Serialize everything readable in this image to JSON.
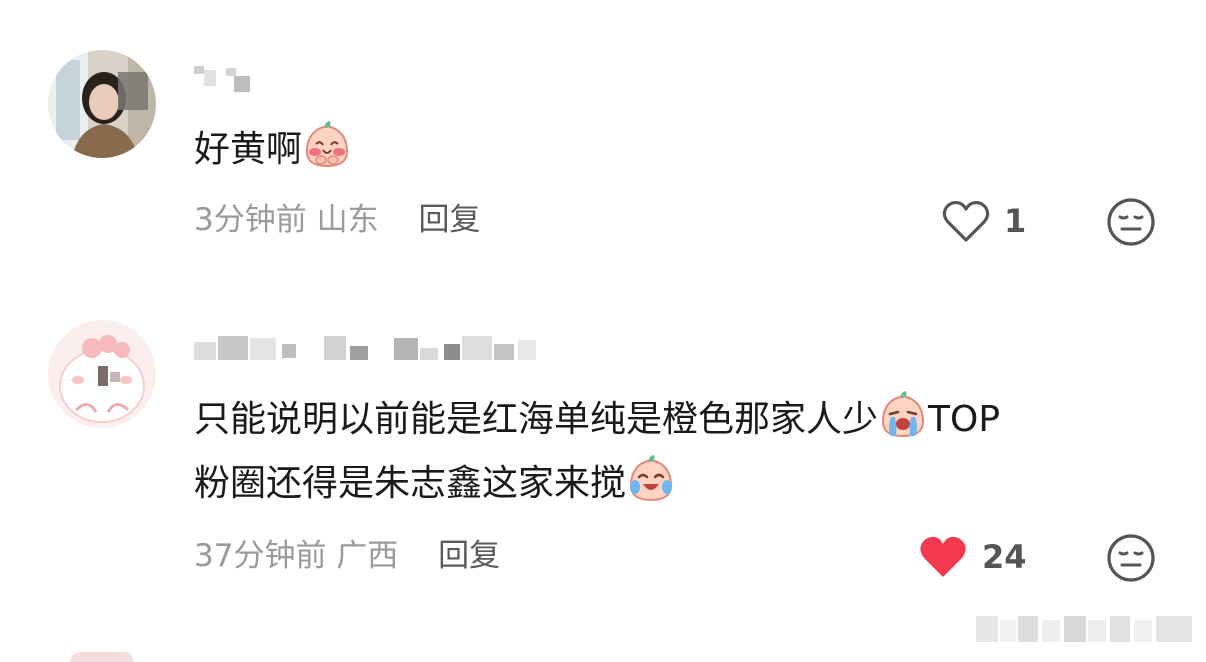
{
  "comments": [
    {
      "content_text": "好黄啊",
      "emoji": "blushing-peach-face-emoji",
      "time": "3分钟前",
      "location": "山东",
      "reply_label": "回复",
      "like_count": "1",
      "liked": false
    },
    {
      "content_line1": "只能说明以前能是红海单纯是橙色那家人少",
      "content_line1_tail": "TOP",
      "content_line2": "粉圈还得是朱志鑫这家来搅",
      "emoji1": "crying-peach-face-emoji",
      "emoji2": "laughing-tears-peach-face-emoji",
      "time": "37分钟前",
      "location": "广西",
      "reply_label": "回复",
      "like_count": "24",
      "liked": true
    }
  ],
  "colors": {
    "liked_heart": "#f2394f",
    "meta_text": "#9a9a9a",
    "reply_text": "#5a5a5a",
    "content_text": "#1a1a1a"
  },
  "icons": [
    "heart-outline-icon",
    "heart-filled-icon",
    "meh-face-dislike-icon"
  ]
}
